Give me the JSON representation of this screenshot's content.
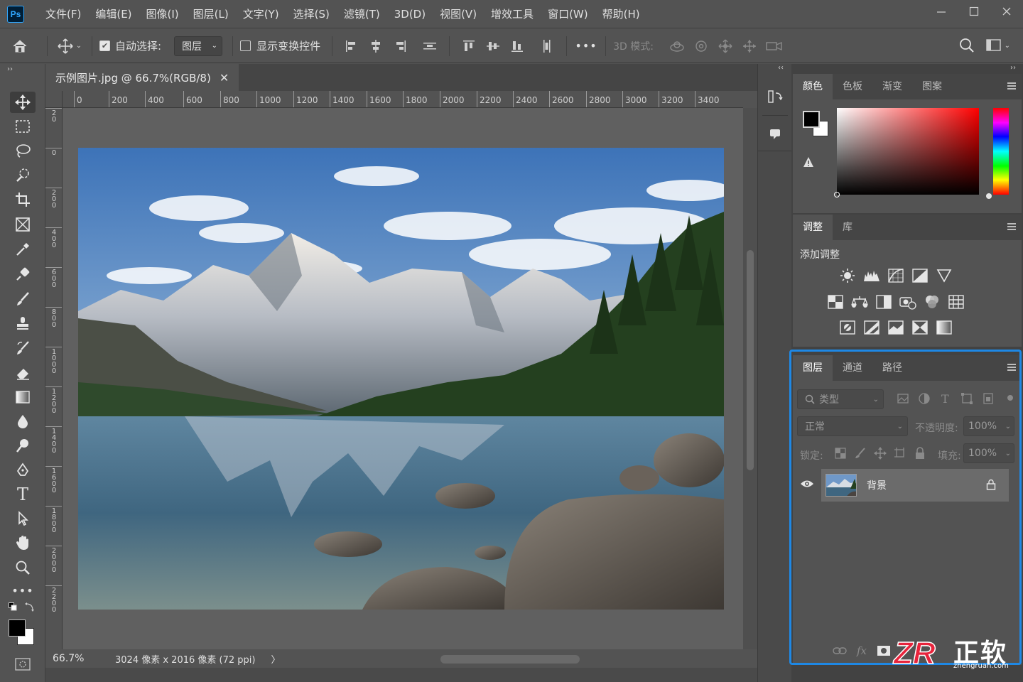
{
  "app": {
    "logo_text": "Ps",
    "menu": [
      "文件(F)",
      "编辑(E)",
      "图像(I)",
      "图层(L)",
      "文字(Y)",
      "选择(S)",
      "滤镜(T)",
      "3D(D)",
      "视图(V)",
      "增效工具",
      "窗口(W)",
      "帮助(H)"
    ]
  },
  "options": {
    "auto_select_label": "自动选择:",
    "auto_select_checked": true,
    "auto_select_value": "图层",
    "transform_controls_label": "显示变换控件",
    "transform_controls_checked": false,
    "more_label": "•••",
    "mode_3d_label": "3D 模式:"
  },
  "document": {
    "tab_title": "示例图片.jpg @ 66.7%(RGB/8)",
    "ruler_h": [
      "0",
      "200",
      "400",
      "600",
      "800",
      "1000",
      "1200",
      "1400",
      "1600",
      "1800",
      "2000",
      "2200",
      "2400",
      "2600",
      "2800",
      "3000",
      "3200",
      "3400"
    ],
    "ruler_v": [
      "2\n0",
      "0",
      "2\n0\n0",
      "4\n0\n0",
      "6\n0\n0",
      "8\n0\n0",
      "1\n0\n0\n0",
      "1\n2\n0\n0",
      "1\n4\n0\n0",
      "1\n6\n0\n0",
      "1\n8\n0\n0",
      "2\n0\n0\n0",
      "2\n2\n0\n0"
    ],
    "zoom": "66.7%",
    "doc_info": "3024 像素 x 2016 像素 (72 ppi)",
    "status_arrow": "〉"
  },
  "color_panel": {
    "tabs": [
      "颜色",
      "色板",
      "渐变",
      "图案"
    ],
    "active_tab": "颜色",
    "foreground": "#000000",
    "background": "#ffffff",
    "hue_color": "#ff0000"
  },
  "adjust_panel": {
    "tabs": [
      "调整",
      "库"
    ],
    "active_tab": "调整",
    "heading": "添加调整",
    "icons": [
      [
        "brightness-contrast-icon",
        "levels-icon",
        "curves-icon",
        "exposure-icon",
        "vibrance-icon"
      ],
      [
        "hue-saturation-icon",
        "color-balance-icon",
        "black-white-icon",
        "photo-filter-icon",
        "channel-mixer-icon",
        "color-lookup-icon"
      ],
      [
        "invert-icon",
        "posterize-icon",
        "threshold-icon",
        "selective-color-icon",
        "gradient-map-icon"
      ]
    ]
  },
  "layers_panel": {
    "tabs": [
      "图层",
      "通道",
      "路径"
    ],
    "active_tab": "图层",
    "filter_placeholder": "类型",
    "blend_mode": "正常",
    "opacity_label": "不透明度:",
    "opacity_value": "100%",
    "lock_label": "锁定:",
    "fill_label": "填充:",
    "fill_value": "100%",
    "layers": [
      {
        "name": "背景",
        "visible": true,
        "locked": true
      }
    ],
    "footer_fx": "fx"
  },
  "watermark": {
    "logo": "ZR",
    "name": "正软",
    "url": "zhengruan.com"
  },
  "colors": {
    "ui_bg": "#535353",
    "panel_dark": "#454545",
    "highlight": "#1e88e5",
    "brand_red": "#e8243c"
  }
}
